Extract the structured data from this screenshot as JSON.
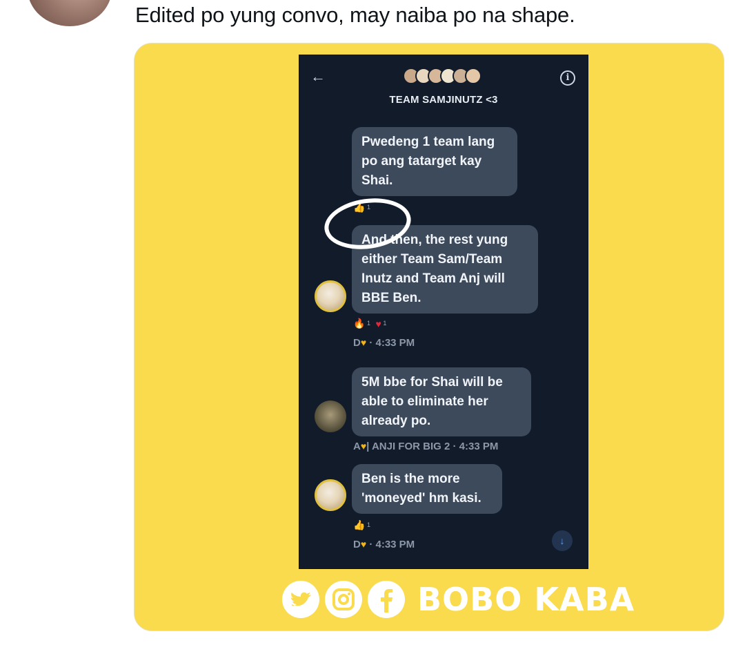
{
  "tweet": {
    "text": "Edited po yung convo, may naiba po na shape."
  },
  "chat": {
    "group_title": "TEAM SAMJINUTZ <3",
    "back_icon": "arrow-left-icon",
    "info_icon": "info-icon",
    "info_glyph": "i",
    "back_glyph": "←",
    "messages": [
      {
        "lines": [
          "Pwedeng 1 team lang",
          "po ang tatarget kay",
          "Shai."
        ],
        "reaction_count": "1"
      },
      {
        "lines": [
          "And then, the rest yung",
          "either Team Sam/Team",
          "Inutz and Team Anj will",
          "BBE Ben."
        ],
        "reactions": [
          {
            "icon": "fire-icon",
            "count": "1"
          },
          {
            "icon": "heart-icon",
            "count": "1"
          }
        ],
        "sender_prefix": "D",
        "time": "· 4:33 PM"
      },
      {
        "lines": [
          "5M bbe for Shai will be",
          "able to eliminate her",
          "already po."
        ],
        "sender_prefix": "A",
        "sender_suffix": "| ANJI FOR BIG 2",
        "time": "· 4:33 PM"
      },
      {
        "lines": [
          "Ben is the more",
          "'moneyed' hm kasi."
        ],
        "reaction_count": "1",
        "sender_prefix": "D",
        "time": "· 4:33 PM"
      }
    ],
    "scroll_glyph": "↓"
  },
  "watermark": {
    "text": "BOBO KABA"
  },
  "colors": {
    "card_bg": "#f9db4d",
    "chat_bg": "#111b2a",
    "bubble_bg": "#3d4a5c",
    "heart_gold": "#f1b41c"
  }
}
